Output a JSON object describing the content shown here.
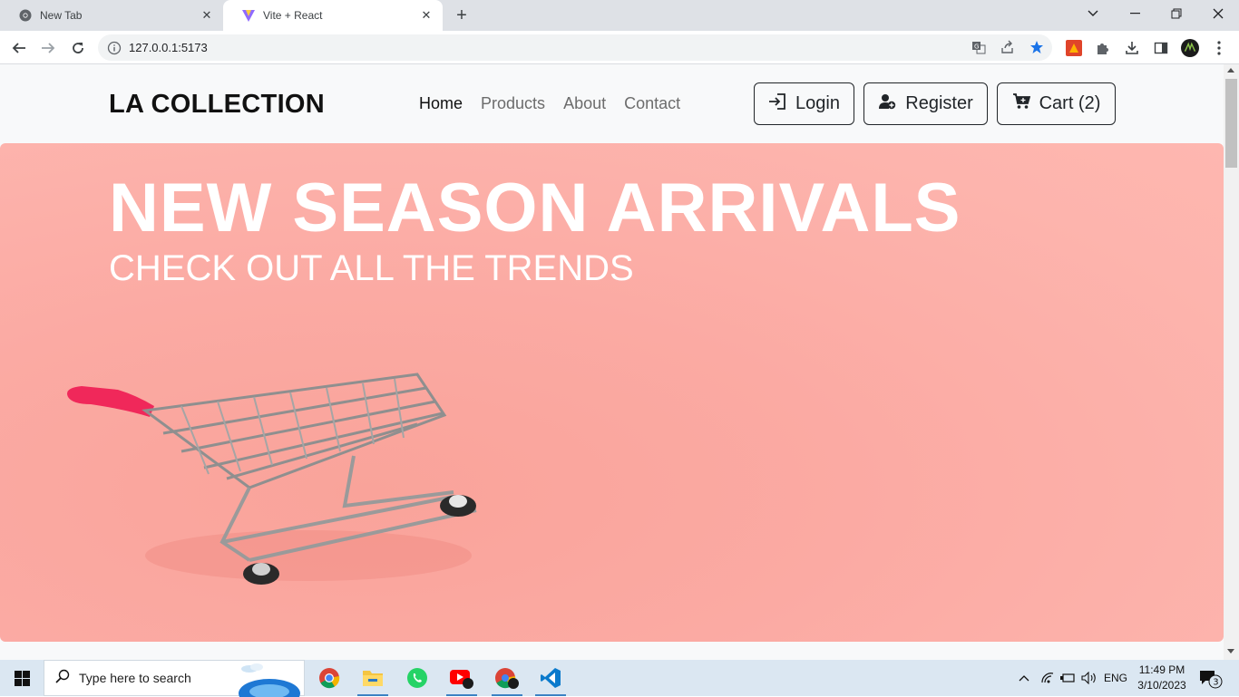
{
  "browser": {
    "tabs": [
      {
        "title": "New Tab",
        "active": false
      },
      {
        "title": "Vite + React",
        "active": true
      }
    ],
    "url": "127.0.0.1:5173"
  },
  "site": {
    "brand": "LA COLLECTION",
    "nav": [
      "Home",
      "Products",
      "About",
      "Contact"
    ],
    "active_nav": "Home",
    "buttons": {
      "login": "Login",
      "register": "Register",
      "cart": "Cart (2)"
    },
    "hero": {
      "title": "NEW SEASON ARRIVALS",
      "subtitle": "CHECK OUT ALL THE TRENDS",
      "colors": {
        "background": "#fdb1aa",
        "text": "#ffffff",
        "cart_handle": "#f0285a"
      }
    }
  },
  "taskbar": {
    "search_placeholder": "Type here to search",
    "language": "ENG",
    "time": "11:49 PM",
    "date": "3/10/2023",
    "notification_count": "3"
  }
}
